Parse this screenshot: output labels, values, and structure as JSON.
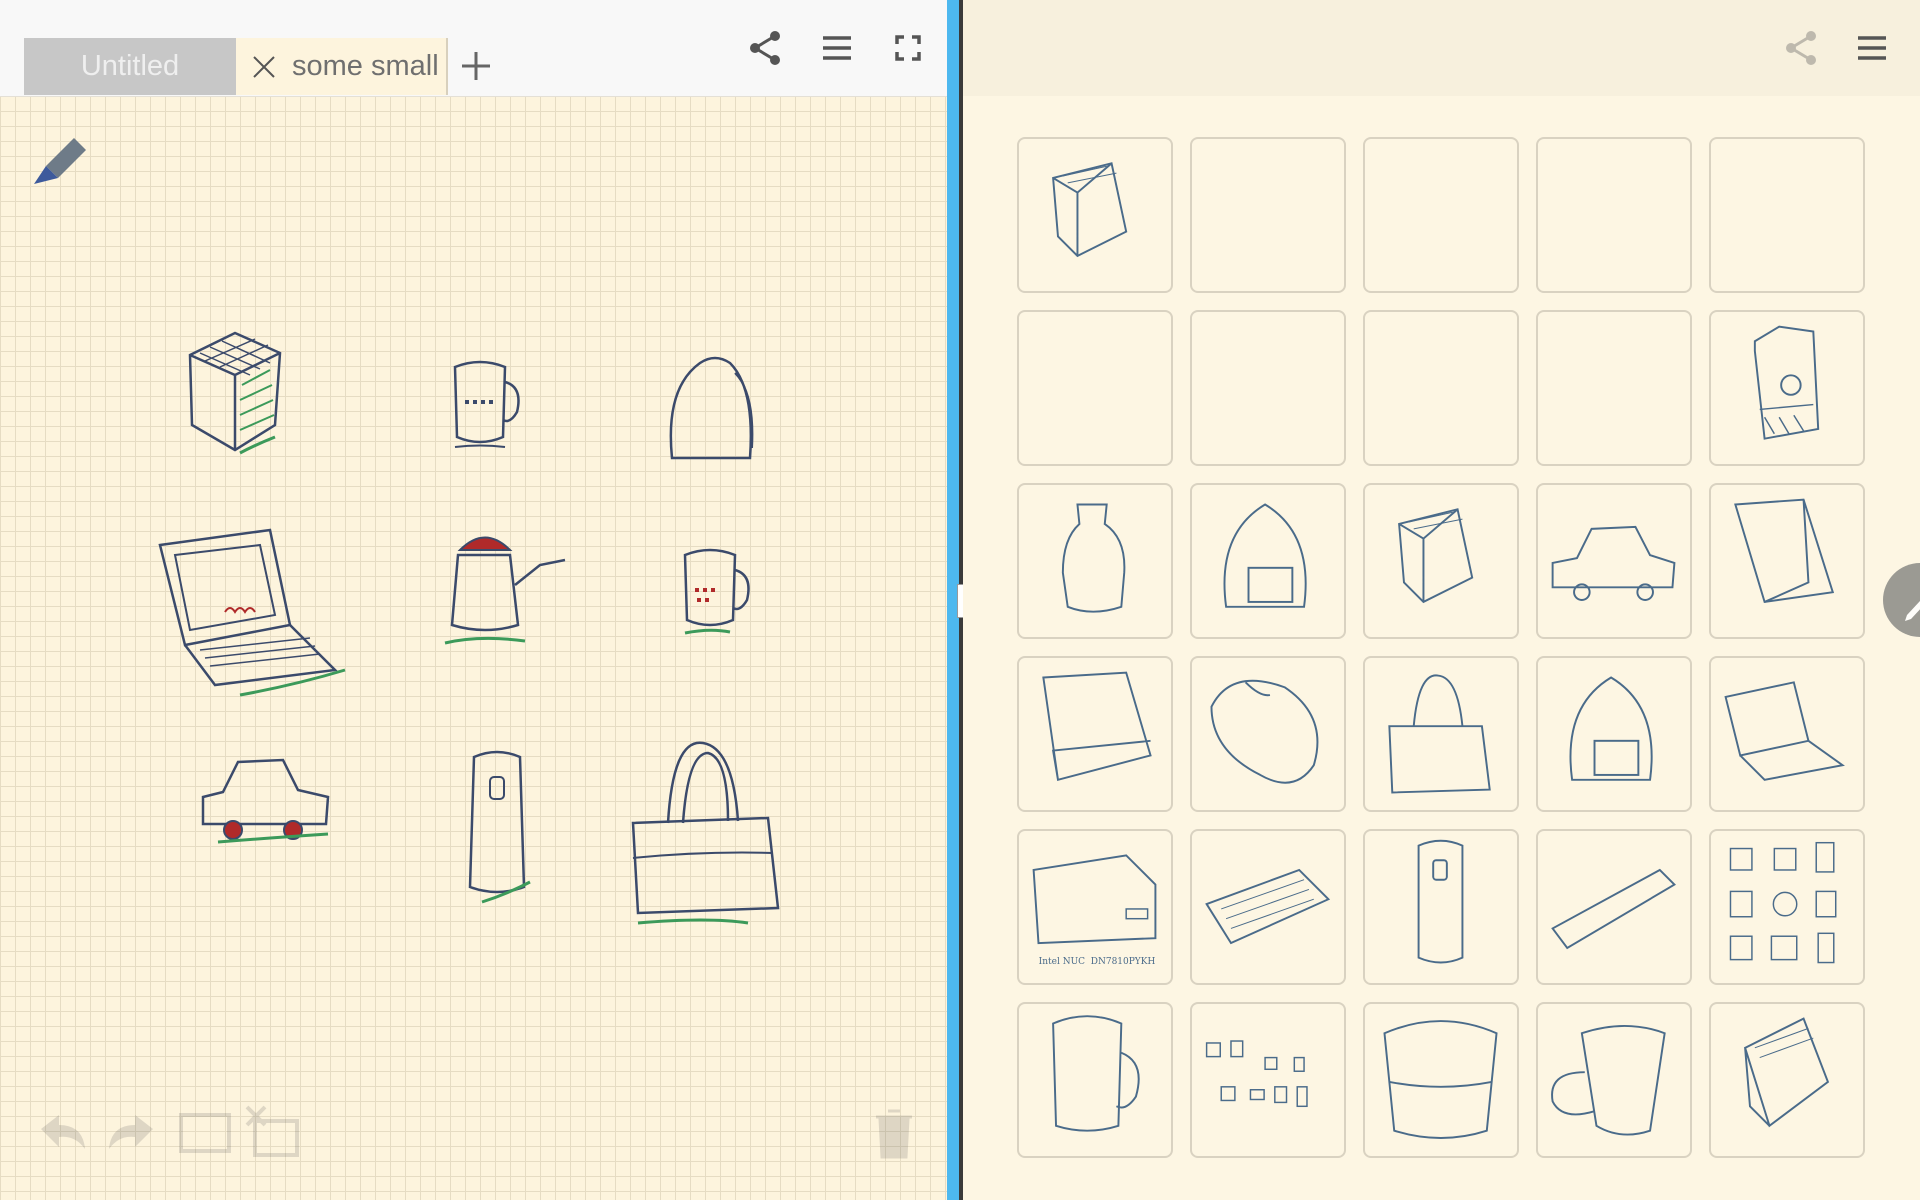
{
  "left_pane": {
    "tabs": [
      {
        "label": "Untitled",
        "state": "inactive"
      },
      {
        "label": "some small",
        "state": "active"
      }
    ],
    "toolbar_icons": [
      "share-icon",
      "menu-icon",
      "fullscreen-icon"
    ],
    "tools": [
      "pen-icon",
      "undo-icon",
      "redo-icon",
      "select-rect-icon",
      "delete-selection-icon",
      "trash-icon"
    ],
    "sketches": [
      "cube",
      "mug",
      "backpack",
      "laptop",
      "watering-can",
      "mug-red",
      "car",
      "thermos",
      "handbag"
    ],
    "colors": {
      "ink": "#3b4a6b",
      "accent_red": "#b02a2a",
      "accent_green": "#3c9a5a",
      "grid": "#e6dcc3",
      "paper": "#fdf4dd"
    }
  },
  "right_pane": {
    "toolbar_icons": [
      "share-icon",
      "menu-icon"
    ],
    "gallery": [
      "cube",
      "blank",
      "blank",
      "blank",
      "blank",
      "blank",
      "blank",
      "blank",
      "blank",
      "milk-carton",
      "bottle",
      "backpack",
      "cube",
      "car",
      "book",
      "box",
      "mouse",
      "handbag",
      "backpack",
      "laptop",
      "nuc-box",
      "keyboard",
      "thermos",
      "pen",
      "collection",
      "mug",
      "collection-small",
      "bucket",
      "cup",
      "book-box"
    ],
    "nuc_caption": "Intel NUC  DN7810PYKH"
  },
  "divider": {
    "color": "#4db8ef"
  }
}
